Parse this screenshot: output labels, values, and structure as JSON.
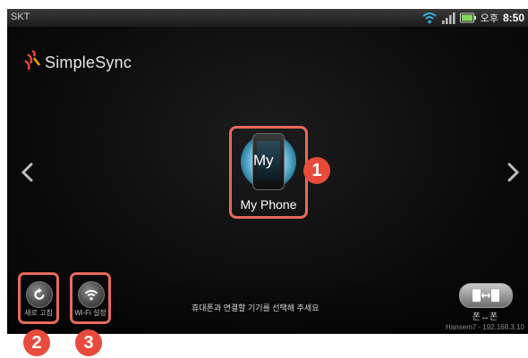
{
  "status_bar": {
    "carrier": "SKT",
    "ampm": "오후",
    "time": "8:50"
  },
  "app": {
    "logo_text": "SimpleSync"
  },
  "device": {
    "overlay_text": "My",
    "name": "My Phone"
  },
  "buttons": {
    "refresh_label": "새로 고침",
    "wifi_label": "Wi-Fi 설정",
    "sync_label": "폰↔폰"
  },
  "hint": "휴대폰과 연결할 기기를 선택해 주세요",
  "footer": {
    "ip_info": "Hansem7 - 192.168.3.10"
  },
  "callouts": [
    "1",
    "2",
    "3"
  ],
  "colors": {
    "highlight": "#e86a5b",
    "callout": "#e84a3c",
    "background": "#0b0b0b"
  }
}
